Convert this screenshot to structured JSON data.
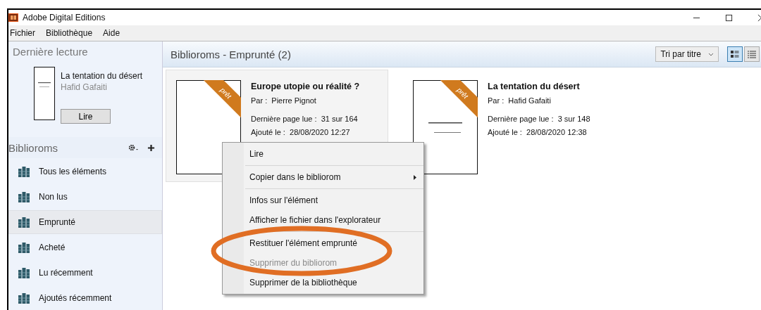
{
  "window": {
    "title": "Adobe Digital Editions"
  },
  "menu": [
    "Fichier",
    "Bibliothèque",
    "Aide"
  ],
  "sidebar": {
    "recent_heading": "Dernière lecture",
    "recent": {
      "title": "La tentation du désert",
      "author": "Hafid Gafaiti",
      "button": "Lire"
    },
    "biblioroms_heading": "Biblioroms",
    "items": [
      {
        "label": "Tous les éléments",
        "selected": false
      },
      {
        "label": "Non lus",
        "selected": false
      },
      {
        "label": "Emprunté",
        "selected": true
      },
      {
        "label": "Acheté",
        "selected": false
      },
      {
        "label": "Lu récemment",
        "selected": false
      },
      {
        "label": "Ajoutés récemment",
        "selected": false
      }
    ]
  },
  "content": {
    "title": "Biblioroms - Emprunté (2)",
    "sort": "Tri par titre",
    "views": [
      {
        "kind": "detail",
        "selected": true
      },
      {
        "kind": "list",
        "selected": false
      }
    ],
    "books": [
      {
        "title": "Europe utopie ou réalité ?",
        "author_label": "Par :",
        "author": "Pierre Pignot",
        "page_label": "Dernière page lue :",
        "page": "31 sur 164",
        "added_label": "Ajouté le :",
        "added": "28/08/2020 12:27",
        "ribbon": "prêt",
        "selected": true
      },
      {
        "title": "La tentation du désert",
        "author_label": "Par :",
        "author": "Hafid Gafaiti",
        "page_label": "Dernière page lue :",
        "page": "3 sur 148",
        "added_label": "Ajouté le :",
        "added": "28/08/2020 12:38",
        "ribbon": "prêt",
        "selected": false
      }
    ]
  },
  "context_menu": [
    {
      "kind": "item",
      "label": "Lire",
      "disabled": false
    },
    {
      "kind": "separator"
    },
    {
      "kind": "submenu",
      "label": "Copier dans le bibliorom",
      "disabled": false
    },
    {
      "kind": "separator"
    },
    {
      "kind": "item",
      "label": "Infos sur l'élément",
      "disabled": false
    },
    {
      "kind": "item",
      "label": "Afficher le fichier dans l'explorateur",
      "disabled": false
    },
    {
      "kind": "separator"
    },
    {
      "kind": "item",
      "label": "Restituer l'élément emprunté",
      "disabled": false
    },
    {
      "kind": "item",
      "label": "Supprimer du bibliorom",
      "disabled": true
    },
    {
      "kind": "item",
      "label": "Supprimer de la bibliothèque",
      "disabled": false
    }
  ],
  "annotation": {
    "kind": "ellipse"
  }
}
